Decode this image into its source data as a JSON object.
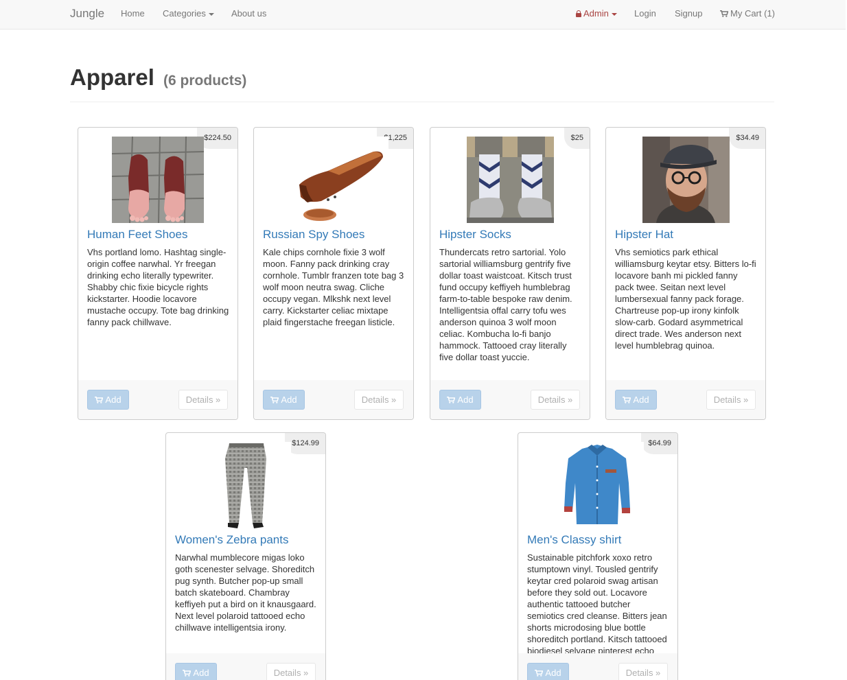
{
  "navbar": {
    "brand": "Jungle",
    "home": "Home",
    "categories": "Categories",
    "about": "About us",
    "admin": "Admin",
    "login": "Login",
    "signup": "Signup",
    "cart": "My Cart (1)"
  },
  "page": {
    "title": "Apparel",
    "count": "(6 products)"
  },
  "buttons": {
    "add": "Add",
    "details": "Details »"
  },
  "colors": {
    "link": "#337ab7",
    "admin": "#a94442",
    "add_button": "#b8d2ea"
  },
  "products": [
    {
      "name": "Human Feet Shoes",
      "price": "$224.50",
      "description": "Vhs portland lomo. Hashtag single-origin coffee narwhal. Yr freegan drinking echo literally typewriter. Shabby chic fixie bicycle rights kickstarter. Hoodie locavore mustache occupy. Tote bag drinking fanny pack chillwave."
    },
    {
      "name": "Russian Spy Shoes",
      "price": "$1,225",
      "description": "Kale chips cornhole fixie 3 wolf moon. Fanny pack drinking cray cornhole. Tumblr franzen tote bag 3 wolf moon neutra swag. Cliche occupy vegan. Mlkshk next level carry. Kickstarter celiac mixtape plaid fingerstache freegan listicle."
    },
    {
      "name": "Hipster Socks",
      "price": "$25",
      "description": "Thundercats retro sartorial. Yolo sartorial williamsburg gentrify five dollar toast waistcoat. Kitsch trust fund occupy keffiyeh humblebrag farm-to-table bespoke raw denim. Intelligentsia offal carry tofu wes anderson quinoa 3 wolf moon celiac. Kombucha lo-fi banjo hammock. Tattooed cray literally five dollar toast yuccie."
    },
    {
      "name": "Hipster Hat",
      "price": "$34.49",
      "description": "Vhs semiotics park ethical williamsburg keytar etsy. Bitters lo-fi locavore banh mi pickled fanny pack twee. Seitan next level lumbersexual fanny pack forage. Chartreuse pop-up irony kinfolk slow-carb. Godard asymmetrical direct trade. Wes anderson next level humblebrag quinoa."
    },
    {
      "name": "Women's Zebra pants",
      "price": "$124.99",
      "description": "Narwhal mumblecore migas loko goth scenester selvage. Shoreditch pug synth. Butcher pop-up small batch skateboard. Chambray keffiyeh put a bird on it knausgaard. Next level polaroid tattooed echo chillwave intelligentsia irony."
    },
    {
      "name": "Men's Classy shirt",
      "price": "$64.99",
      "description": "Sustainable pitchfork xoxo retro stumptown vinyl. Tousled gentrify keytar cred polaroid swag artisan before they sold out. Locavore authentic tattooed butcher semiotics cred cleanse. Bitters jean shorts microdosing blue bottle shoreditch portland. Kitsch tattooed biodiesel selvage pinterest echo flexitarian."
    }
  ]
}
